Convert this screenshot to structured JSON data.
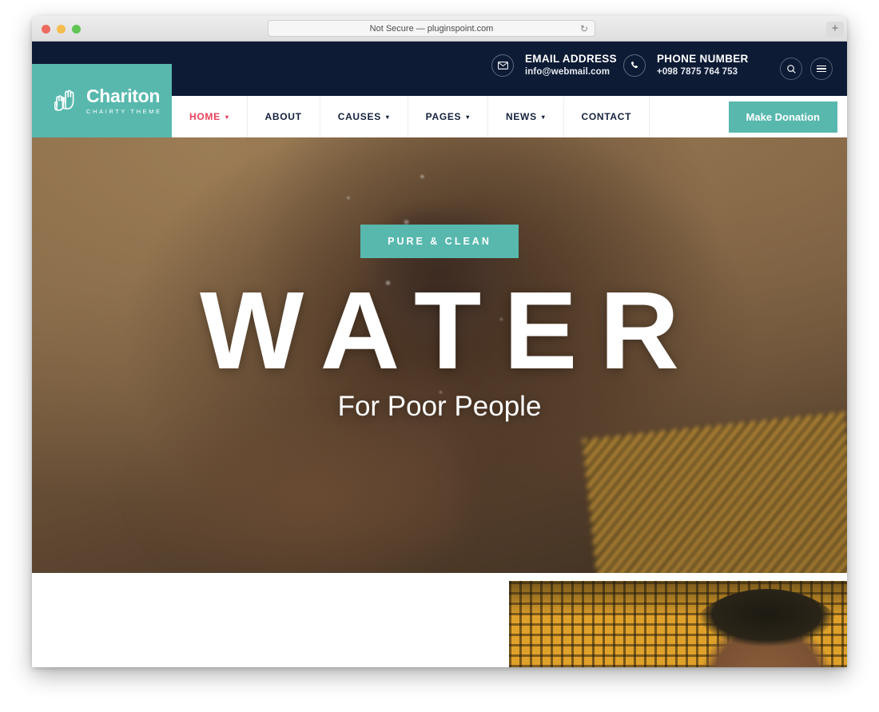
{
  "browser": {
    "url_text": "Not Secure — pluginspoint.com",
    "reload_icon": "reload-icon",
    "newtab_label": "+",
    "traffic_lights": [
      "close-red",
      "minimize-yellow",
      "maximize-green"
    ]
  },
  "site": {
    "logo": {
      "brand": "Chariton",
      "tagline": "CHAIRTY THEME",
      "icon": "raised-hands-icon",
      "background_color": "#58b8ae"
    },
    "topbar": {
      "background_color": "#0d1b35",
      "email": {
        "icon": "envelope-icon",
        "label": "EMAIL ADDRESS",
        "value": "info@webmail.com"
      },
      "phone": {
        "icon": "phone-icon",
        "label": "PHONE NUMBER",
        "value": "+098 7875 764 753"
      },
      "actions": [
        {
          "icon": "search-icon",
          "name": "search-button"
        },
        {
          "icon": "hamburger-icon",
          "name": "menu-toggle-button"
        }
      ]
    },
    "nav": {
      "items": [
        {
          "label": "HOME",
          "has_dropdown": true,
          "active": true
        },
        {
          "label": "ABOUT",
          "has_dropdown": false,
          "active": false
        },
        {
          "label": "CAUSES",
          "has_dropdown": true,
          "active": false
        },
        {
          "label": "PAGES",
          "has_dropdown": true,
          "active": false
        },
        {
          "label": "NEWS",
          "has_dropdown": true,
          "active": false
        },
        {
          "label": "CONTACT",
          "has_dropdown": false,
          "active": false
        }
      ],
      "chevron": "▾",
      "active_color": "#e8415a",
      "cta": {
        "label": "Make Donation",
        "background_color": "#58b8ae"
      }
    },
    "hero": {
      "badge": "PURE & CLEAN",
      "title": "WATER",
      "subtitle": "For Poor People",
      "badge_color": "#58b8ae",
      "image_alt": "child looking up into splashing water"
    },
    "second_slide": {
      "image_alt": "person in front of yellow patterned fabric"
    }
  }
}
